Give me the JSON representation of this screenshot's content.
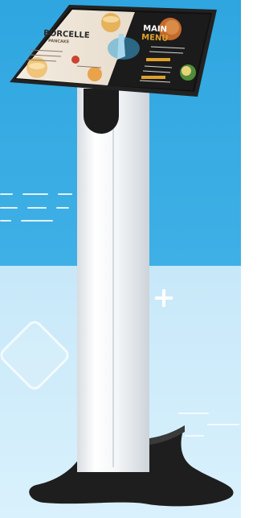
{
  "scene": {
    "colors": {
      "backdrop_top": "#2fa6e0",
      "backdrop_bottom": "#cde9f8",
      "kiosk_body": "#ffffff",
      "kiosk_base": "#1e1e1e"
    }
  },
  "menu_board": {
    "left_brand_line1": "BORCELLE",
    "left_brand_line2": "PANCAKE",
    "right_title_line1": "MAIN",
    "right_title_line2": "MENU"
  }
}
